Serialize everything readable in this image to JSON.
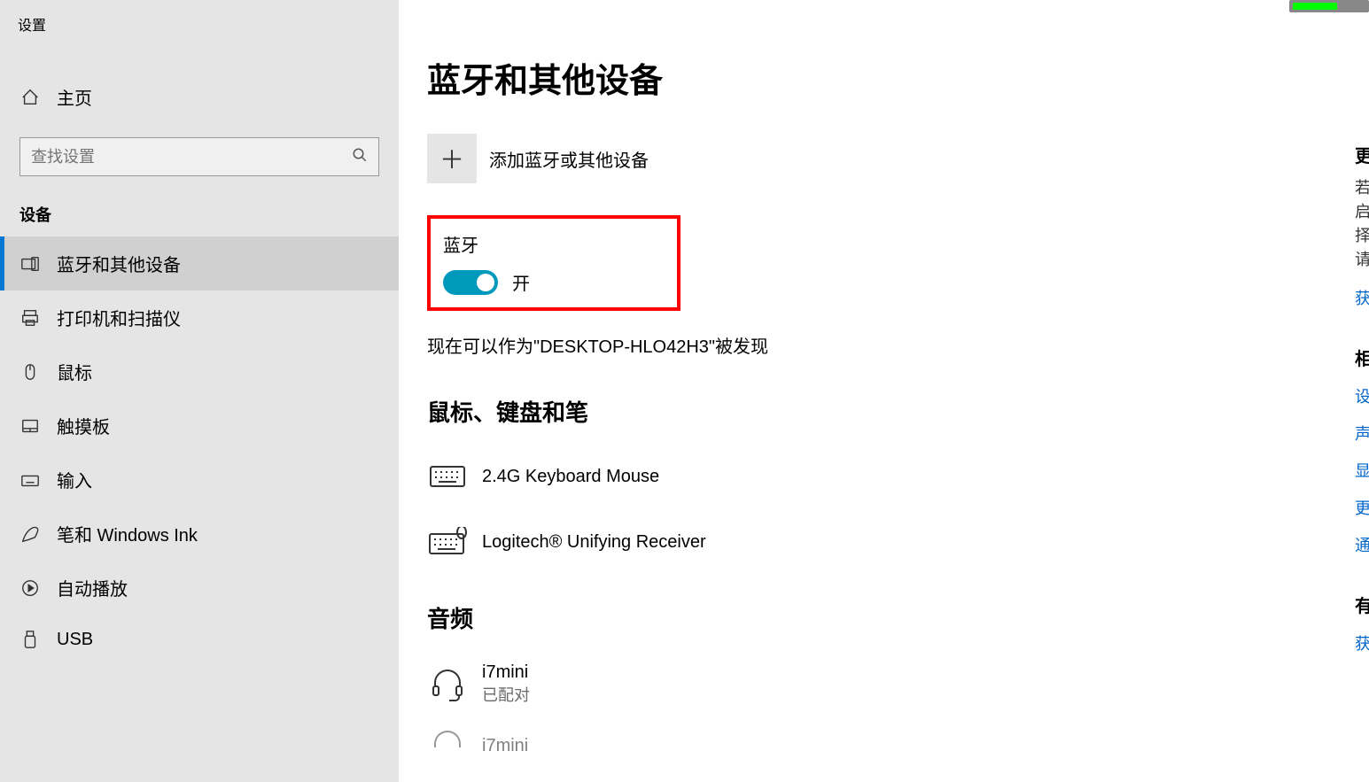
{
  "app_title": "设置",
  "sidebar": {
    "home": "主页",
    "search_placeholder": "查找设置",
    "section": "设备",
    "items": [
      {
        "label": "蓝牙和其他设备"
      },
      {
        "label": "打印机和扫描仪"
      },
      {
        "label": "鼠标"
      },
      {
        "label": "触摸板"
      },
      {
        "label": "输入"
      },
      {
        "label": "笔和 Windows Ink"
      },
      {
        "label": "自动播放"
      },
      {
        "label": "USB"
      }
    ]
  },
  "main": {
    "title": "蓝牙和其他设备",
    "add_device": "添加蓝牙或其他设备",
    "bluetooth_label": "蓝牙",
    "toggle_state": "开",
    "discoverable": "现在可以作为\"DESKTOP-HLO42H3\"被发现",
    "category1": "鼠标、键盘和笔",
    "device1": "2.4G Keyboard Mouse",
    "device2": "Logitech® Unifying Receiver",
    "category2": "音频",
    "device3_name": "i7mini",
    "device3_status": "已配对",
    "device4_name": "i7mini"
  },
  "right": {
    "heading1": "更",
    "text1": "若",
    "text2": "启",
    "text3": "择",
    "text4": "请",
    "link1": "获",
    "heading2": "相",
    "link2": "设",
    "link3": "声",
    "link4": "显",
    "link5": "更",
    "link6": "通",
    "heading3": "有",
    "link7": "获"
  }
}
